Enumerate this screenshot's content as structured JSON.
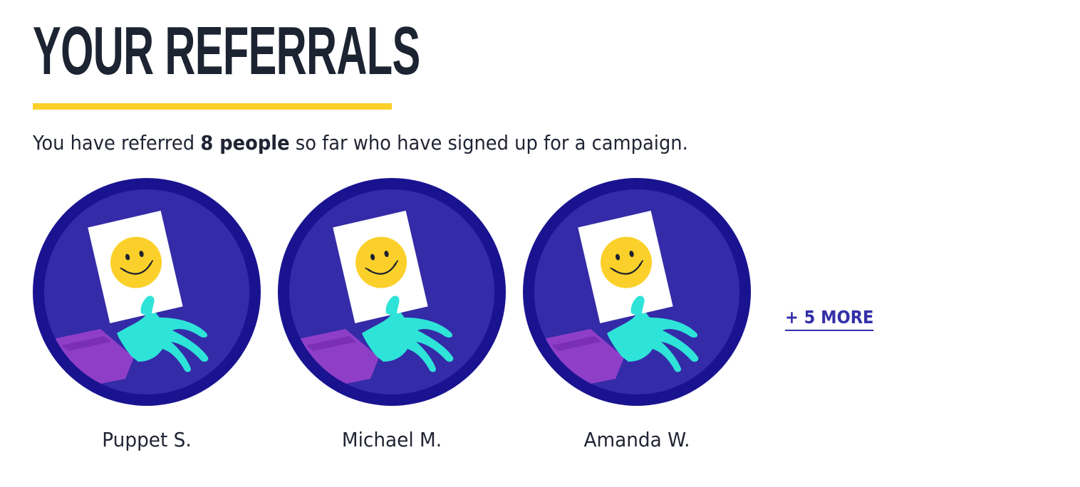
{
  "page": {
    "title": "YOUR REFERRALS"
  },
  "summary": {
    "prefix": "You have referred ",
    "count_text": "8 people",
    "suffix": " so far who have signed up for a campaign."
  },
  "referrals": [
    {
      "name": "Puppet S.",
      "icon": "hand-holding-smiley-sign-icon"
    },
    {
      "name": "Michael M.",
      "icon": "hand-holding-smiley-sign-icon"
    },
    {
      "name": "Amanda W.",
      "icon": "hand-holding-smiley-sign-icon"
    }
  ],
  "more_link": {
    "label": "+ 5 MORE"
  },
  "colors": {
    "accent_underline": "#fcd02a",
    "badge_outer": "#1a1390",
    "badge_inner": "#342ba8",
    "link": "#3430a8",
    "hand": "#2ee3d8",
    "sleeve": "#8f3ec8",
    "smiley": "#fcd02a"
  }
}
